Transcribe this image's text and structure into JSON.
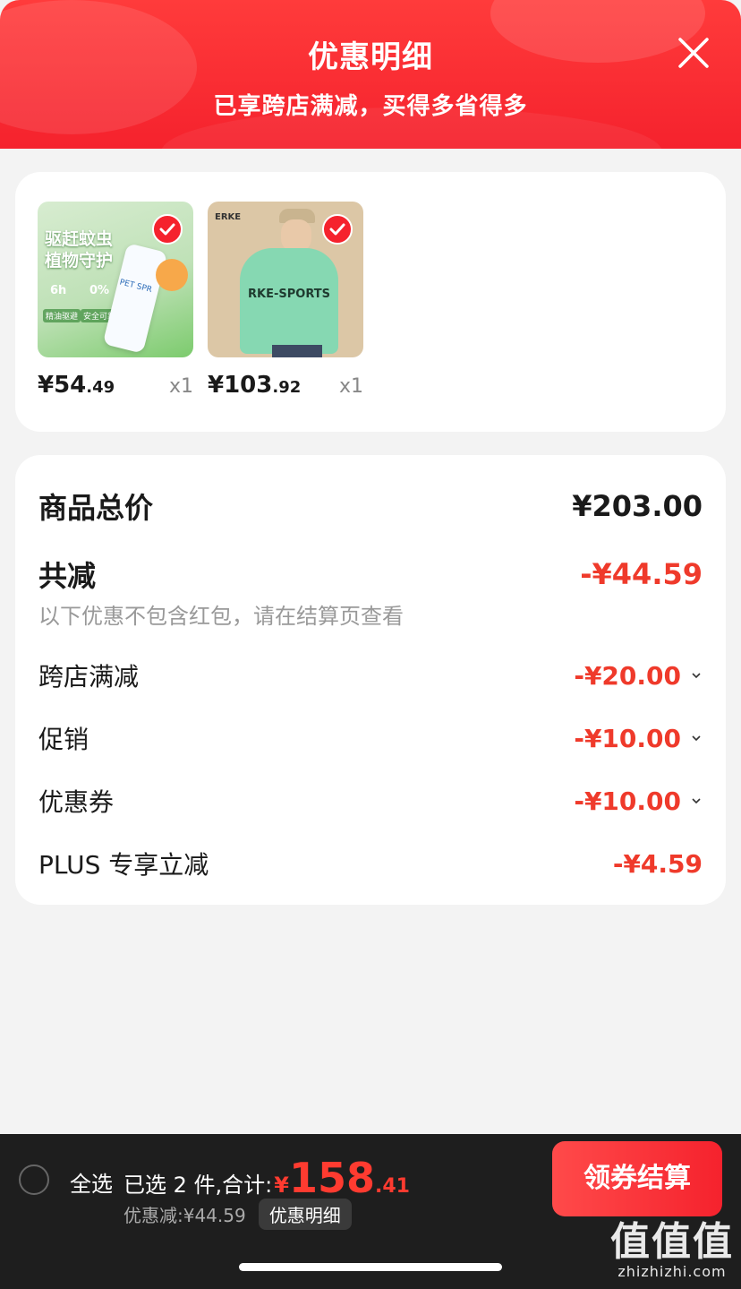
{
  "header": {
    "title": "优惠明细",
    "subtitle": "已享跨店满减，买得多省得多"
  },
  "products": [
    {
      "price_int": "¥54",
      "price_dec": ".49",
      "qty": "x1",
      "thumb_text": [
        "驱赶蚊虫",
        "植物守护",
        "6h",
        "0%",
        "精油驱避",
        "安全可靠",
        "PET SPR"
      ]
    },
    {
      "price_int": "¥103",
      "price_dec": ".92",
      "qty": "x1",
      "thumb_text": [
        "ERKE",
        "RKE-SPORTS"
      ]
    }
  ],
  "breakdown": {
    "total_label": "商品总价",
    "total_value": "¥203.00",
    "reduce_label": "共减",
    "reduce_value": "-¥44.59",
    "note": "以下优惠不包含红包，请在结算页查看",
    "items": [
      {
        "label": "跨店满减",
        "value": "-¥20.00"
      },
      {
        "label": "促销",
        "value": "-¥10.00"
      },
      {
        "label": "优惠券",
        "value": "-¥10.00"
      },
      {
        "label": "PLUS 专享立减",
        "value": "-¥4.59"
      }
    ]
  },
  "bottom": {
    "select_all": "全选",
    "selected": "已选 2 件,合计:",
    "total_yen": "¥",
    "total_int": "158",
    "total_dec": ".41",
    "discount": "优惠减:¥44.59",
    "detail_button": "优惠明细",
    "checkout_button": "领券结算"
  },
  "watermark": {
    "big": "值值值",
    "small": "zhizhizhi.com"
  },
  "colors": {
    "accent_red": "#f5222d",
    "price_red": "#ef3a2b",
    "bottom_bg": "#1e1e1e"
  }
}
